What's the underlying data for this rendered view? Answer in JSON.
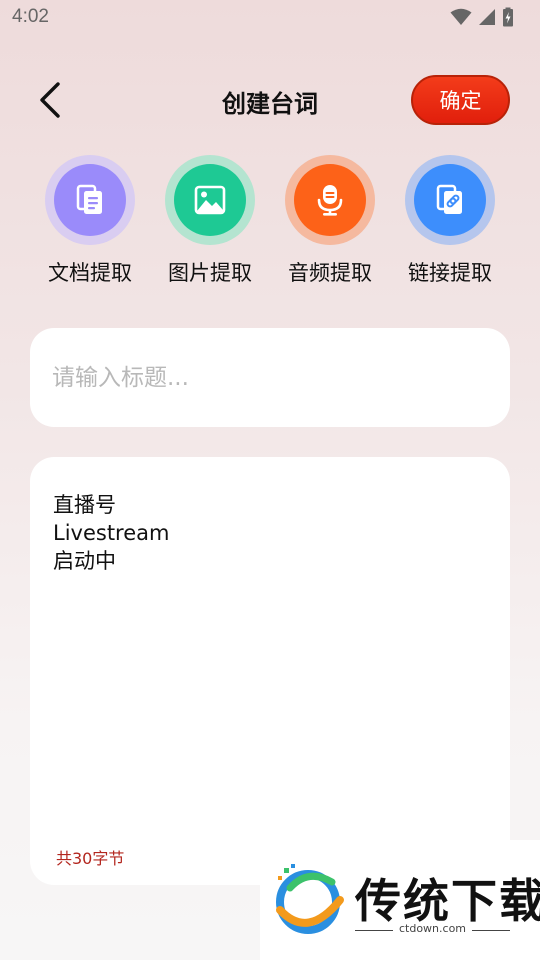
{
  "status_bar": {
    "time": "4:02"
  },
  "header": {
    "title": "创建台词",
    "confirm_label": "确定"
  },
  "tools": [
    {
      "label": "文档提取",
      "icon": "document-icon",
      "outer": "#d9cdf1",
      "inner": "#9a8bfa"
    },
    {
      "label": "图片提取",
      "icon": "image-icon",
      "outer": "#b4e4d0",
      "inner": "#1ec994"
    },
    {
      "label": "音频提取",
      "icon": "microphone-icon",
      "outer": "#f5b99f",
      "inner": "#fd6218"
    },
    {
      "label": "链接提取",
      "icon": "link-icon",
      "outer": "#b5c6ed",
      "inner": "#3d8efc"
    }
  ],
  "title_input": {
    "placeholder": "请输入标题...",
    "value": ""
  },
  "content": {
    "text": "直播号\nLivestream\n启动中",
    "count_label": "共30字节"
  },
  "watermark": {
    "text": "传统下载",
    "url": "ctdown.com"
  }
}
